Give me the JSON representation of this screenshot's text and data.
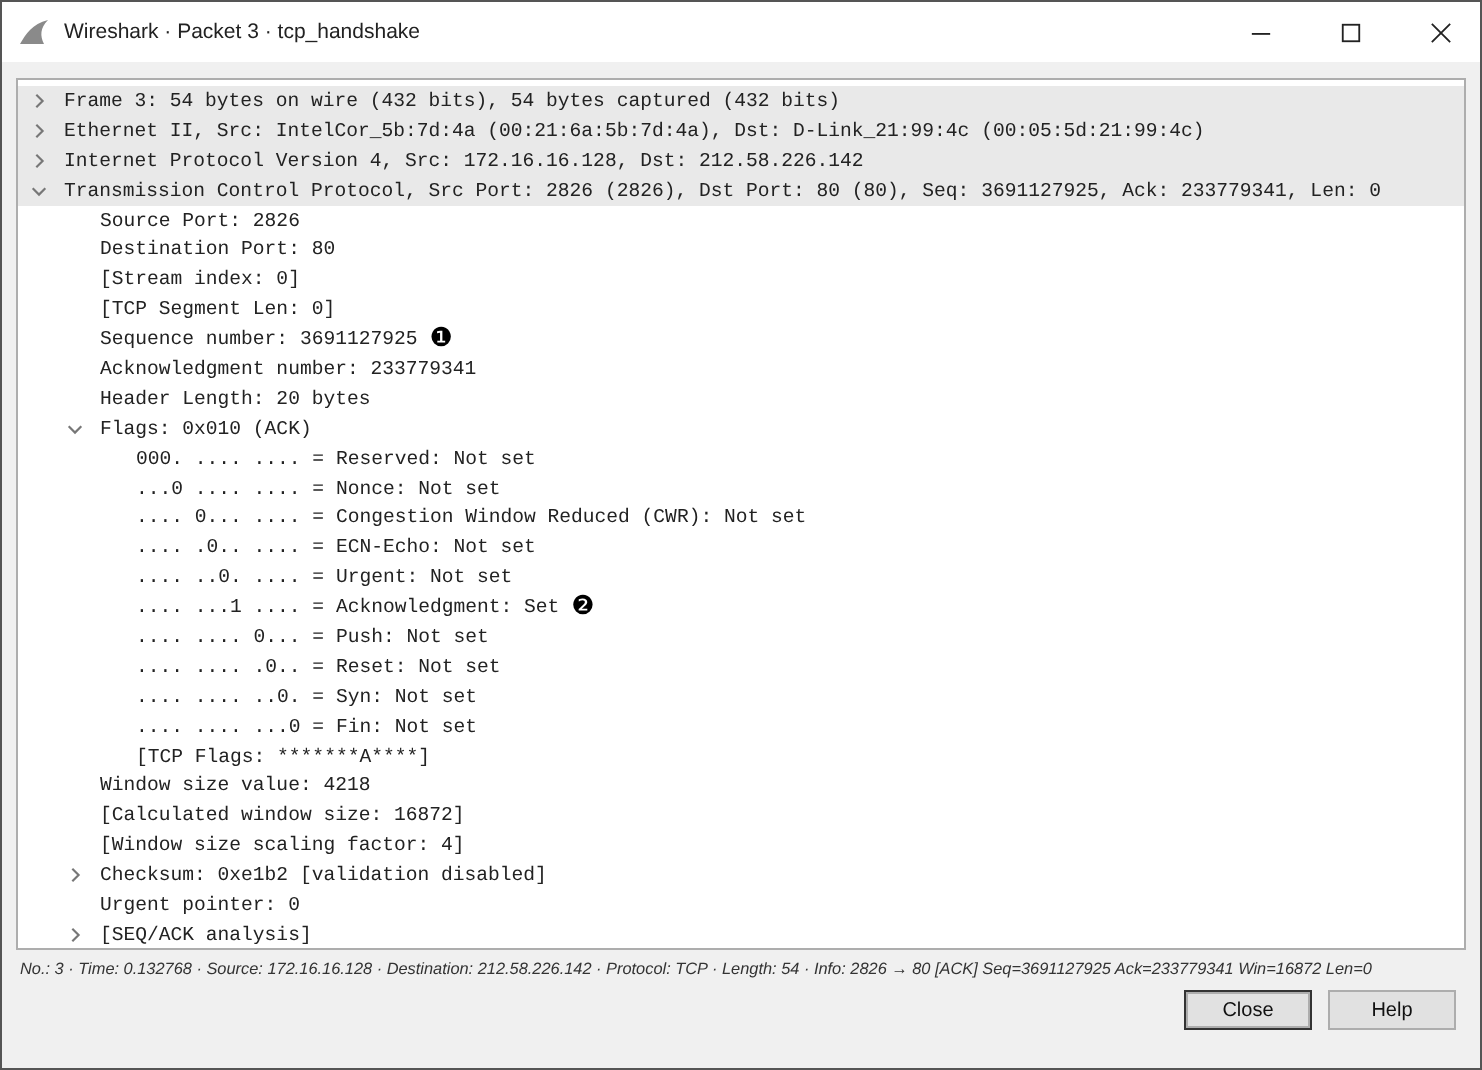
{
  "window": {
    "title": "Wireshark · Packet 3 · tcp_handshake"
  },
  "tree": [
    {
      "label": "Frame 3: 54 bytes on wire (432 bits), 54 bytes captured (432 bits)",
      "expanded": false
    },
    {
      "label": "Ethernet II, Src: IntelCor_5b:7d:4a (00:21:6a:5b:7d:4a), Dst: D-Link_21:99:4c (00:05:5d:21:99:4c)",
      "expanded": false
    },
    {
      "label": "Internet Protocol Version 4, Src: 172.16.16.128, Dst: 212.58.226.142",
      "expanded": false
    },
    {
      "label": "Transmission Control Protocol, Src Port: 2826 (2826), Dst Port: 80 (80), Seq: 3691127925, Ack: 233779341, Len: 0",
      "expanded": true,
      "children": [
        {
          "label": "Source Port: 2826"
        },
        {
          "label": "Destination Port: 80"
        },
        {
          "label": "[Stream index: 0]"
        },
        {
          "label": "[TCP Segment Len: 0]"
        },
        {
          "label": "Sequence number: 3691127925",
          "callout": "❶"
        },
        {
          "label": "Acknowledgment number: 233779341"
        },
        {
          "label": "Header Length: 20 bytes"
        },
        {
          "label": "Flags: 0x010 (ACK)",
          "expanded": true,
          "children": [
            {
              "label": "000. .... .... = Reserved: Not set"
            },
            {
              "label": "...0 .... .... = Nonce: Not set"
            },
            {
              "label": ".... 0... .... = Congestion Window Reduced (CWR): Not set"
            },
            {
              "label": ".... .0.. .... = ECN-Echo: Not set"
            },
            {
              "label": ".... ..0. .... = Urgent: Not set"
            },
            {
              "label": ".... ...1 .... = Acknowledgment: Set",
              "callout": "❷"
            },
            {
              "label": ".... .... 0... = Push: Not set"
            },
            {
              "label": ".... .... .0.. = Reset: Not set"
            },
            {
              "label": ".... .... ..0. = Syn: Not set"
            },
            {
              "label": ".... .... ...0 = Fin: Not set"
            },
            {
              "label": "[TCP Flags: *******A****]"
            }
          ]
        },
        {
          "label": "Window size value: 4218"
        },
        {
          "label": "[Calculated window size: 16872]"
        },
        {
          "label": "[Window size scaling factor: 4]"
        },
        {
          "label": "Checksum: 0xe1b2 [validation disabled]",
          "expanded": false
        },
        {
          "label": "Urgent pointer: 0"
        },
        {
          "label": "[SEQ/ACK analysis]",
          "expanded": false
        }
      ]
    }
  ],
  "status_line": "No.: 3 · Time: 0.132768 · Source: 172.16.16.128 · Destination: 212.58.226.142 · Protocol: TCP · Length: 54 · Info: 2826 → 80 [ACK] Seq=3691127925 Ack=233779341 Win=16872 Len=0",
  "buttons": [
    {
      "label": "Close",
      "selected": true
    },
    {
      "label": "Help",
      "selected": false
    }
  ]
}
